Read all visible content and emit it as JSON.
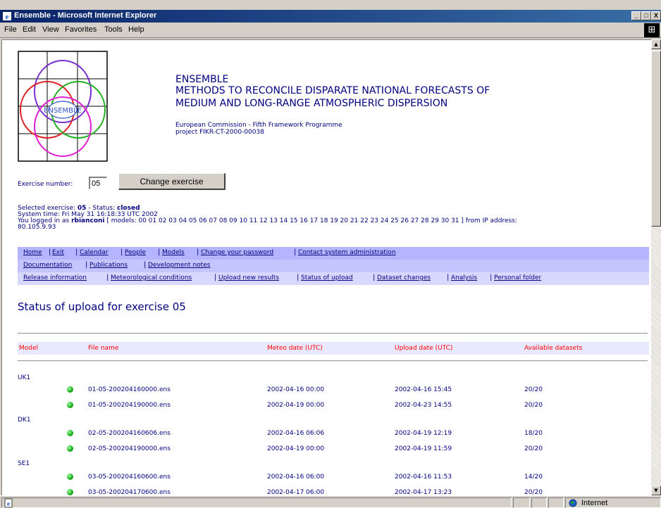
{
  "window": {
    "title": "Ensemble - Microsoft Internet Explorer",
    "minimize_label": "_",
    "restore_label": "□",
    "close_label": "X"
  },
  "menu": {
    "items": [
      {
        "label": "File"
      },
      {
        "label": "Edit"
      },
      {
        "label": "View"
      },
      {
        "label": "Favorites"
      },
      {
        "label": "Tools"
      },
      {
        "label": "Help"
      }
    ]
  },
  "header": {
    "logo_text": "ENSEMBLE",
    "name": "ENSEMBLE",
    "subtitle_line1": "METHODS TO RECONCILE DISPARATE NATIONAL FORECASTS OF",
    "subtitle_line2": "MEDIUM AND LONG-RANGE ATMOSPHERIC DISPERSION",
    "programme": "European Commission - Fifth Framework Programme",
    "project": "project FIKR-CT-2000-00038"
  },
  "exercise": {
    "label": "Exercise number:",
    "value": "05",
    "button_label": "Change exercise"
  },
  "info": {
    "selected_prefix": "Selected exercise: ",
    "selected_value": "05",
    "status_prefix": " - Status: ",
    "status_value": "closed",
    "system_time": "System time: Fri May 31 16:18:33 UTC 2002",
    "logged_prefix": "You logged in as ",
    "user": "rbianconi",
    "models_text": " [ models: 00 01 02 03 04 05 06 07 08 09 10 11 12 13 14 15 16 17 18 19 20 21 22 23 24 25 26 27 28 29 30 31 ] from IP address:",
    "ip": "80.105.9.93"
  },
  "nav": {
    "row1": [
      "Home",
      "Exit",
      "Calendar",
      "People",
      "Models",
      "Change your password",
      "Contact system administration"
    ],
    "row2": [
      "Documentation",
      "Publications",
      "Development notes"
    ],
    "row3": [
      "Release information",
      "Meteorological conditions",
      "Upload new results",
      "Status of upload",
      "Dataset changes",
      "Analysis",
      "Personal folder"
    ],
    "colors": {
      "row1": "#b4b4ff",
      "row2": "#c4c4ff",
      "row3": "#d8d8ff"
    }
  },
  "page_title": "Status of upload for exercise 05",
  "table": {
    "headers": {
      "model": "Model",
      "file": "File name",
      "meteo": "Meteo date (UTC)",
      "upload": "Upload date (UTC)",
      "datasets": "Available datasets"
    },
    "groups": [
      {
        "model": "UK1",
        "rows": [
          {
            "file": "01-05-200204160000.ens",
            "meteo": "2002-04-16 00:00",
            "upload": "2002-04-16 15:45",
            "datasets": "20/20"
          },
          {
            "file": "01-05-200204190000.ens",
            "meteo": "2002-04-19 00:00",
            "upload": "2002-04-23 14:55",
            "datasets": "20/20"
          }
        ]
      },
      {
        "model": "DK1",
        "rows": [
          {
            "file": "02-05-200204160606.ens",
            "meteo": "2002-04-16 06:06",
            "upload": "2002-04-19 12:19",
            "datasets": "18/20"
          },
          {
            "file": "02-05-200204190000.ens",
            "meteo": "2002-04-19 00:00",
            "upload": "2002-04-19 11:59",
            "datasets": "20/20"
          }
        ]
      },
      {
        "model": "SE1",
        "rows": [
          {
            "file": "03-05-200204160600.ens",
            "meteo": "2002-04-16 06:00",
            "upload": "2002-04-16 11:53",
            "datasets": "14/20"
          },
          {
            "file": "03-05-200204170600.ens",
            "meteo": "2002-04-17 06:00",
            "upload": "2002-04-17 13:23",
            "datasets": "20/20"
          }
        ]
      }
    ]
  },
  "statusbar": {
    "zone": "Internet"
  }
}
